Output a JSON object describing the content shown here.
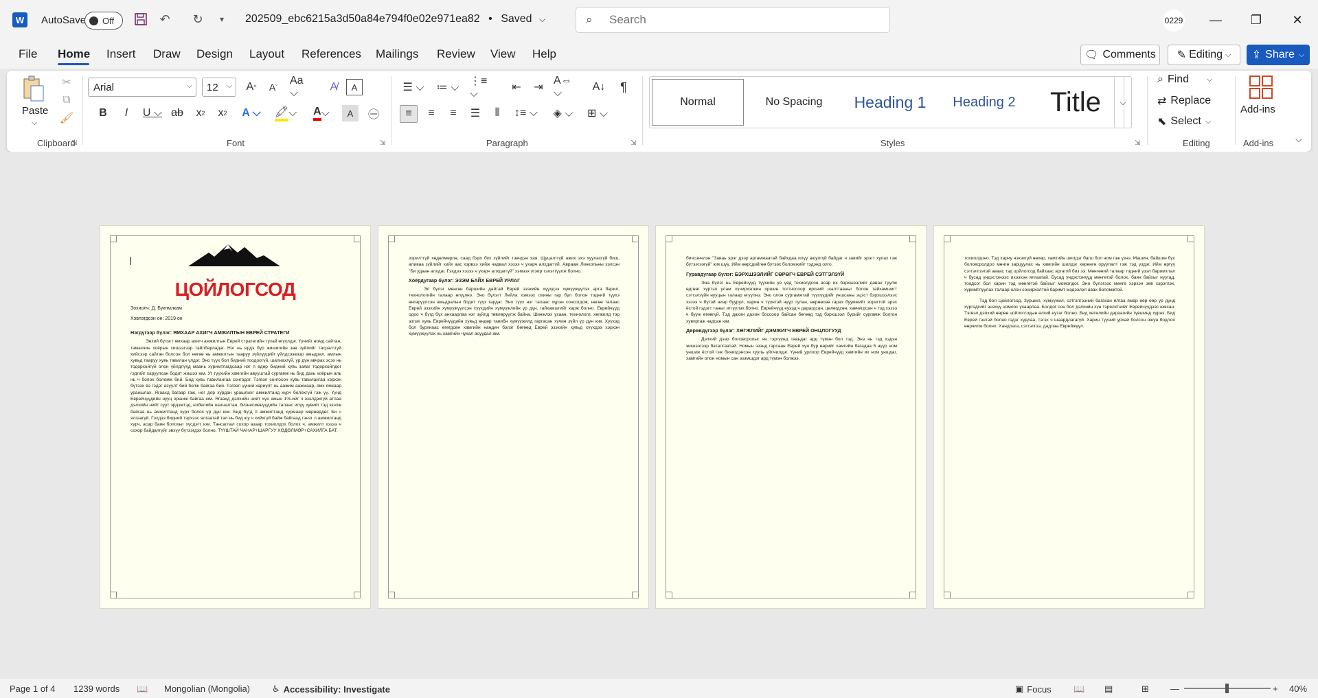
{
  "titlebar": {
    "autosave_label": "AutoSave",
    "autosave_state": "Off",
    "doc_title": "202509_ebc6215a3d50a84e794f0e02e971ea82",
    "save_status": "Saved",
    "search_placeholder": "Search",
    "user_initials": "0229"
  },
  "menu": {
    "items": [
      "File",
      "Home",
      "Insert",
      "Draw",
      "Design",
      "Layout",
      "References",
      "Mailings",
      "Review",
      "View",
      "Help"
    ],
    "active": "Home",
    "comments_label": "Comments",
    "editing_label": "Editing",
    "share_label": "Share"
  },
  "ribbon": {
    "clipboard": {
      "paste_label": "Paste",
      "group_label": "Clipboard"
    },
    "font": {
      "font_name": "Arial",
      "font_size": "12",
      "group_label": "Font"
    },
    "paragraph": {
      "group_label": "Paragraph"
    },
    "styles": {
      "items": [
        "Normal",
        "No Spacing",
        "Heading 1",
        "Heading 2",
        "Title"
      ],
      "group_label": "Styles"
    },
    "editing": {
      "find": "Find",
      "replace": "Replace",
      "select": "Select",
      "group_label": "Editing"
    },
    "addins": {
      "label": "Add-ins",
      "group_label": "Add-ins"
    }
  },
  "pages": {
    "p1": {
      "logo_text": "ЦОЙЛОГСОД",
      "author": "Зохиолч: Д. Букнмлкам",
      "year": "Хэвлэгдсэн он: 2019 он",
      "heading": "Нэгдүгээр бүлэг: ЯМХААР АХИГЧ АМЖИЛТЫН ЕВРЕЙ СТРАТЕГИ",
      "body": "Энхий бүлэгт ямхаар ахигч амжилтын Еврей стратегийн тухай өгүүлдэг. Үүнийг номд сайтан, тамахчин хоёрын хишээгээр тайлбарладаг. Нэг нь ердэ бүр жишигийн зөв зүйлийг тасралтгүй хийсээр сайтан болсон бол нөгөө нь амжилтын тааруу зүйлүүдийг үйлдсээвээр амьдрал, амлын хувьд тааруу хувь тавилан үлдэг. Эно түүх бол бидний тоодоогүй, шалиахгүй, ур дүн авчрах эсэх нь тодорхойгүй олон үйлдлүүд маань хуримтлагдсаар нэг л өдөр бидний хувь заяаг тодорхойлдог гэдгийг харуулсан бодит жишээ юм. Уг түүхийн хамгийн авууштай сургамж нь бид дахь хоёрын аль нь ч болох боломж бий. Бид хувь тавилангаа сонгодог. Тэгвэл сонгосон хувь тавилангаа хэрхэн бүтээх вэ гэдэг асуулт бий болж байгаа бий. Тэгвэл үүний хариулт нь аажим аажмаар, ямх ямхаар ураншлах. Ягаахд багаар гаж, ног дор хурдан урашлихг амжилтанд хүрч болохгүй гэж үү. Үүнд Еврейчүүдийн нууц оршиж байгаа юм. Ягаахд дэлхийн нийт хүн амын 1%-ийг ч эзэлдэхгүй атлаа дэлхийн нийт суут эрдэмтэд, нобелийн шагналтан, бизнесменүүдийн талаас илүү хувийг тэд эзэлж байгаа нь амжилтанд хүрч болох үр дүн юм. Бид бүгд л амжилтанд хүрмаар мөрөөддөг. Би ч ялгаагүй. Гэхдээ бидний тэрхээс ялгаатай тал нь бид юу ч хийхгүй байж байгаад гэнэт л амжилтанд хүрч, асар баян болохыг хүсдэгт юм. Тансаглал сохор азаар тохиолдох болох ч, амжилт хэзээ ч сохор байдалгүйг эвхүү бүтээгдэх болно. ТҮҮШТАЙ ЧАНАР+ШАРГУУ ХӨДӨЛМӨР+САХИЛГА БАТ."
    },
    "p2": {
      "intro": "зорилтгүй хөдөлмөрлө, саад бэрх бүх зүйлийг тэвчдэн хая. Щуцалтгүй ажих эхэ хуулахгүй биш, аливаа зүйлийг хийх аас хэрвээ хийж чадвал хэзээ ч ухарч алхдаггүй. Авраам Линкольны хэлсэн \"Би удаан алхдаг. Гэхдээ хэзээ ч ухарч алхдаггүй\" хэмээх үгэир тэлэгтүүлж болно.",
      "heading": "Хоёрдугаар бүлэг: ЭЗЭМ БАЙХ ЕВРЕЙ УРЛАГ",
      "body": "Эл бүлэг мөнгөн баршийн дайтай Еврей эзэхийн хүүхдээ хүмүүжүүлэх арга барил, технологийн талаар өгүүлнэ. Эно бүлэгт Лейла хэмээх охины гар бүл болон тэдний түүхэ өнгөрүүлсэн амьдралын бодит түүх гардаг. Эно түүх нэг талаас хүрэн сонсогдож, нөгөө талаас Еврей эзэхийн хүмүүжүүлсэн хүүхдийн хүмүүжлийн үр дүн, гайхамшгийг харж болно. Еврейчүүд одоо ч бүгд бүх анхаарлаа нэг зүйлд төвлөрүүлж байна. Шинжлэх ухаан, технологи, хөгжилд тэр эзлэх хувь Еврейчүүдийн хувьд өндөр тавибн хүмүүжилд гаргасан хүчин зүйл үр дүн юм. Хүүхэд бол бурхнаас өгөгдсөн хамгийн нандин бэлэг бөгөөд Еврей эзэхийн хувьд хүүхдээ хэрхэн хүмүүжүүлэх нь хамгийн чухал асуудал юм."
    },
    "p3": {
      "intro": "бичсэнчлэн \"Заваь эрэг дээр аргамжаатай байхдаа илүү аюулгүй байдаг ч завийг эрэгт хулах гэж бүтээгээгүй\" юм шүү. Ийм өөрсдийгөө бүтээх боломжийг тэдэнд олго.",
      "heading1": "Гуравдугаар бүлэг: БЭРХШЭЭЛИЙГ СӨРӨГЧ ЕВРЕЙ СЭТГЭЛЗҮЙ",
      "body1": "Эна бүлэг нь Еврейчүүд түүхийн үе үед тохиолдсон асар их бэрхшээлийг даван туулж өдгөөг хүртэл улам хүчирхэгжин оршин тогтносоор ирсний шалтгааныг болон тайхамшигт сэтгэлзүйн нууцын талаар өгүүлнэ. Эно олон сургамжтай түүхүүдийг уншсаны эцэст бэрхшээлээс хэзээ ч бүтэй ниэр буурул, харин ч түүнтэй нүүр тулан, өөрөөсөө гарах буумжийг зоригтой эрэх ёстой гэдэгт таныг итгүүлэх болно. Еврейчүүд еуээд ч дарагдсан, цөлөгдсөн, хавчигдсан ч тэд хэзээ ч бууж өгөөгүй. Тэд дахин дахин боссоор байсан бөгөөд тэд бэрхшээл бүрийг сургамж болгон хувиргаж чадсан юм.",
      "heading2": "Дөрөвдүгээр бүлэг: ХӨГЖЛИЙГ ДЭМЖИГЧ ЕВРЕЙ ОНЦЛОГУУД",
      "body2": "Дэлхий дээр боловсролыг ян тэргүүнд тавьдаг ард түмэн бол тэд. Энэ нь тэд хэдэн жишээгээр баталгаатай. Номын эзэнд гарсаан Еврей хүн бүр өөрийг хамгийн багадаа 5 нүүр ном уншиж ёстой гэж бичигдэнсэн хууль үйлчилдэг. Үүний урлоор Еврейчүүд хамгийн их ном уншдаг, хамгийн олон номын сан эзэмшдэг ард түмэн болжээ."
    },
    "p4": {
      "body1": "тохиолдоно. Тэд хариу нэхэхгүй нөхөр, хамтийн шилдэг багш бол ном гэж үзнэ. Машин, байшин бүс боловсролдоо мөнгө зарцуулах нь хамгийн шилдэг хөрөнгө оруулалт гэж тэд үздэг. Ийм өргүү сэтгэлгээтэй аваас тэд цойлогсод байхаас аргагүй биз ээ. Мөнгөний талаар тэдний үзэл баримтлал ч бусад үндэстэнээс ихээхэн ялгаатай. Бусад үндэстэнүүд мөнгөтэй болох, баян байхыг нуугад, тоодсог бол харин тэд мөнгөтэй байхыг момолдог. Эно бүлэгээс мөнгө хэрхэн зөв хэрэглэх, хуримтлуулах талаар олон сонирхолтой баримт мэдээлэл авах боломжтой.",
      "body2": "Тэд бол Цойлогсод. Зуршил, хүмүүжил, сэтгэлгээний багахан ялгаа ямар өөр өөр үр дүнд хүргэдгийг энэхүү номоос ухаарлаа. Болдог сон бол дэлхийн хүн тэрелхтнийг Еврейчүүдээс юмсан. Тэгвэл дэлхий өөрөө цойлогсодын өлгий нутаг болно. Бид хөгжлийн дараагийн түвшинд хүрнэ. Бид Еврей гэнтэй болно гэдэг худлаа, тэгэх ч шаардлагагүй. Харин түүний урхай болсон оюун бодлоо өөрчилж болно. Хандлага, сэтгэлгээ, дадлаа Еврейжүүл."
    }
  },
  "status": {
    "page": "Page 1 of 4",
    "words": "1239 words",
    "language": "Mongolian (Mongolia)",
    "accessibility": "Accessibility: Investigate",
    "focus": "Focus",
    "zoom": "40%"
  },
  "colors": {
    "accent": "#185abd",
    "logo_red": "#d61f26",
    "page_bg": "#ffffef"
  }
}
